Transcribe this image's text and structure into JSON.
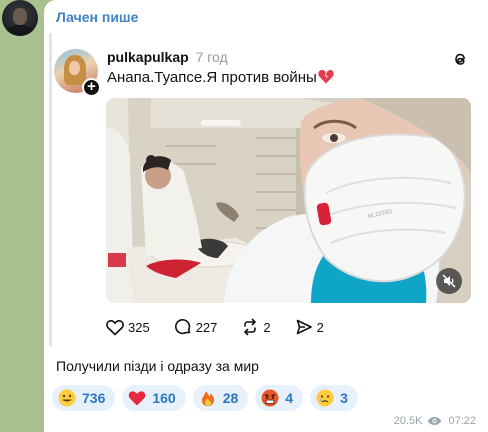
{
  "message": {
    "sender_name": "Лачен пише",
    "text": "Получили пізди і одразу за мир",
    "views": "20.5K",
    "time": "07:22"
  },
  "embedded_post": {
    "author": "pulkapulkap",
    "posted_ago": "7 год",
    "text": "Анапа.Туапсе.Я против войны",
    "text_emoji": "broken-heart-icon",
    "source_icon": "threads-icon",
    "actions": {
      "likes": "325",
      "comments": "227",
      "reposts": "2",
      "shares": "2"
    }
  },
  "reactions": [
    {
      "emoji": "grinning-face-icon",
      "count": "736"
    },
    {
      "emoji": "red-heart-icon",
      "count": "160"
    },
    {
      "emoji": "fire-icon",
      "count": "28"
    },
    {
      "emoji": "angry-face-icon",
      "count": "4"
    },
    {
      "emoji": "crying-face-icon",
      "count": "3"
    }
  ],
  "colors": {
    "chat_background": "#a9c08f",
    "sender_name": "#3f83c4",
    "reaction_pill": "#e7f1fb",
    "reaction_text": "#2c77c0"
  }
}
